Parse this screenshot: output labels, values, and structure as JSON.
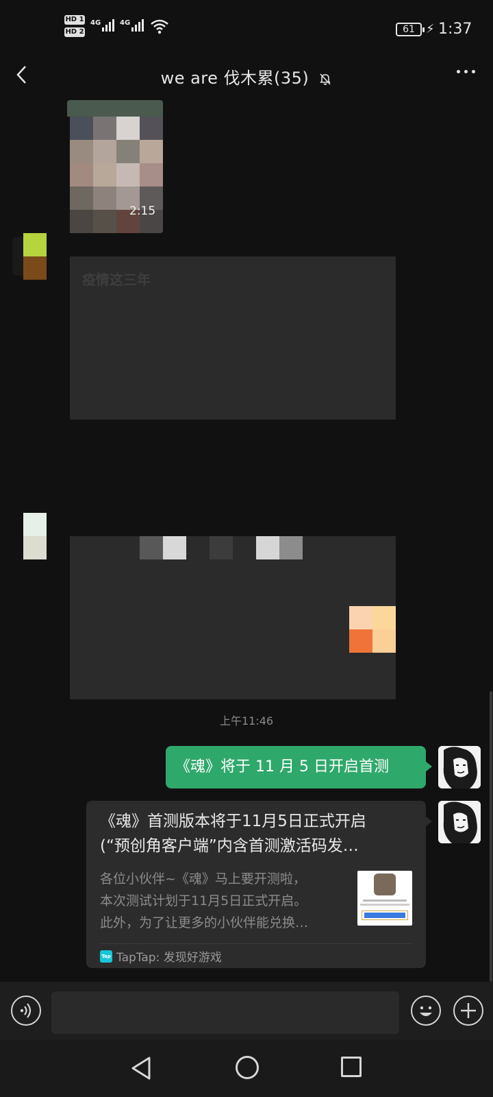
{
  "status_bar": {
    "sim1_label": "HD 1",
    "sim2_label": "HD 2",
    "net1": "4G",
    "net2": "4G",
    "battery": "61",
    "time": "1:37"
  },
  "header": {
    "title": "we  are  伐木累(35)",
    "muted": true
  },
  "messages": {
    "video_duration": "2:15",
    "blurred_text_hint": "疫情这三年",
    "time_divider": "上午11:46",
    "my_text": "《魂》将于 11 月 5 日开启首测",
    "link_card": {
      "title_line1": "《魂》首测版本将于11月5日正式开启",
      "title_line2": "(“预创角客户端”内含首测激活码发…",
      "desc_line1": "各位小伙伴~《魂》马上要开测啦，",
      "desc_line2": "本次测试计划于11月5日正式开启。",
      "desc_line3": "此外，为了让更多的小伙伴能兑换…",
      "source": "TapTap: 发现好游戏",
      "source_logo": "Tap"
    }
  },
  "colors": {
    "background": "#111111",
    "my_bubble": "#2fa86b",
    "card": "#2c2c2c"
  }
}
